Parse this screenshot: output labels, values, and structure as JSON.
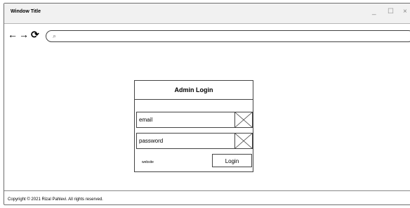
{
  "window": {
    "title": "Window Title",
    "minimize_glyph": "_",
    "maximize_glyph": "☐",
    "close_glyph": "×"
  },
  "nav": {
    "back_glyph": "←",
    "forward_glyph": "→",
    "reload_glyph": "⟳",
    "search_glyph": "⌕",
    "address_value": ""
  },
  "login": {
    "title": "Admin Login",
    "email_label": "email",
    "password_label": "password",
    "website_link": "website",
    "login_button": "Login"
  },
  "footer": {
    "copyright": "Copyright © 2021 Rizal Pahlevi. All rights reserved."
  },
  "icons": {
    "email_field_icon": "image-placeholder-icon",
    "password_field_icon": "image-placeholder-icon"
  }
}
